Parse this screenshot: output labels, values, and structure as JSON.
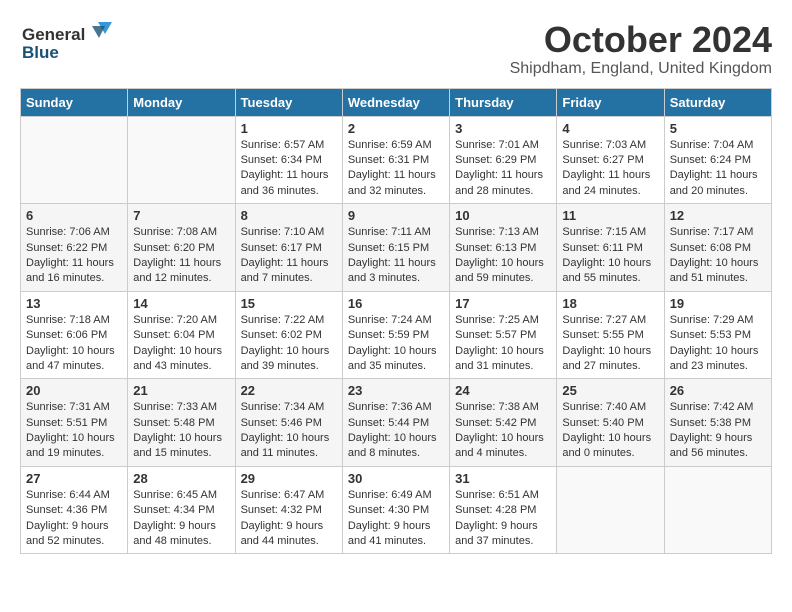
{
  "header": {
    "logo_general": "General",
    "logo_blue": "Blue",
    "month_title": "October 2024",
    "location": "Shipdham, England, United Kingdom"
  },
  "days_of_week": [
    "Sunday",
    "Monday",
    "Tuesday",
    "Wednesday",
    "Thursday",
    "Friday",
    "Saturday"
  ],
  "weeks": [
    [
      {
        "day": "",
        "sunrise": "",
        "sunset": "",
        "daylight": ""
      },
      {
        "day": "",
        "sunrise": "",
        "sunset": "",
        "daylight": ""
      },
      {
        "day": "1",
        "sunrise": "Sunrise: 6:57 AM",
        "sunset": "Sunset: 6:34 PM",
        "daylight": "Daylight: 11 hours and 36 minutes."
      },
      {
        "day": "2",
        "sunrise": "Sunrise: 6:59 AM",
        "sunset": "Sunset: 6:31 PM",
        "daylight": "Daylight: 11 hours and 32 minutes."
      },
      {
        "day": "3",
        "sunrise": "Sunrise: 7:01 AM",
        "sunset": "Sunset: 6:29 PM",
        "daylight": "Daylight: 11 hours and 28 minutes."
      },
      {
        "day": "4",
        "sunrise": "Sunrise: 7:03 AM",
        "sunset": "Sunset: 6:27 PM",
        "daylight": "Daylight: 11 hours and 24 minutes."
      },
      {
        "day": "5",
        "sunrise": "Sunrise: 7:04 AM",
        "sunset": "Sunset: 6:24 PM",
        "daylight": "Daylight: 11 hours and 20 minutes."
      }
    ],
    [
      {
        "day": "6",
        "sunrise": "Sunrise: 7:06 AM",
        "sunset": "Sunset: 6:22 PM",
        "daylight": "Daylight: 11 hours and 16 minutes."
      },
      {
        "day": "7",
        "sunrise": "Sunrise: 7:08 AM",
        "sunset": "Sunset: 6:20 PM",
        "daylight": "Daylight: 11 hours and 12 minutes."
      },
      {
        "day": "8",
        "sunrise": "Sunrise: 7:10 AM",
        "sunset": "Sunset: 6:17 PM",
        "daylight": "Daylight: 11 hours and 7 minutes."
      },
      {
        "day": "9",
        "sunrise": "Sunrise: 7:11 AM",
        "sunset": "Sunset: 6:15 PM",
        "daylight": "Daylight: 11 hours and 3 minutes."
      },
      {
        "day": "10",
        "sunrise": "Sunrise: 7:13 AM",
        "sunset": "Sunset: 6:13 PM",
        "daylight": "Daylight: 10 hours and 59 minutes."
      },
      {
        "day": "11",
        "sunrise": "Sunrise: 7:15 AM",
        "sunset": "Sunset: 6:11 PM",
        "daylight": "Daylight: 10 hours and 55 minutes."
      },
      {
        "day": "12",
        "sunrise": "Sunrise: 7:17 AM",
        "sunset": "Sunset: 6:08 PM",
        "daylight": "Daylight: 10 hours and 51 minutes."
      }
    ],
    [
      {
        "day": "13",
        "sunrise": "Sunrise: 7:18 AM",
        "sunset": "Sunset: 6:06 PM",
        "daylight": "Daylight: 10 hours and 47 minutes."
      },
      {
        "day": "14",
        "sunrise": "Sunrise: 7:20 AM",
        "sunset": "Sunset: 6:04 PM",
        "daylight": "Daylight: 10 hours and 43 minutes."
      },
      {
        "day": "15",
        "sunrise": "Sunrise: 7:22 AM",
        "sunset": "Sunset: 6:02 PM",
        "daylight": "Daylight: 10 hours and 39 minutes."
      },
      {
        "day": "16",
        "sunrise": "Sunrise: 7:24 AM",
        "sunset": "Sunset: 5:59 PM",
        "daylight": "Daylight: 10 hours and 35 minutes."
      },
      {
        "day": "17",
        "sunrise": "Sunrise: 7:25 AM",
        "sunset": "Sunset: 5:57 PM",
        "daylight": "Daylight: 10 hours and 31 minutes."
      },
      {
        "day": "18",
        "sunrise": "Sunrise: 7:27 AM",
        "sunset": "Sunset: 5:55 PM",
        "daylight": "Daylight: 10 hours and 27 minutes."
      },
      {
        "day": "19",
        "sunrise": "Sunrise: 7:29 AM",
        "sunset": "Sunset: 5:53 PM",
        "daylight": "Daylight: 10 hours and 23 minutes."
      }
    ],
    [
      {
        "day": "20",
        "sunrise": "Sunrise: 7:31 AM",
        "sunset": "Sunset: 5:51 PM",
        "daylight": "Daylight: 10 hours and 19 minutes."
      },
      {
        "day": "21",
        "sunrise": "Sunrise: 7:33 AM",
        "sunset": "Sunset: 5:48 PM",
        "daylight": "Daylight: 10 hours and 15 minutes."
      },
      {
        "day": "22",
        "sunrise": "Sunrise: 7:34 AM",
        "sunset": "Sunset: 5:46 PM",
        "daylight": "Daylight: 10 hours and 11 minutes."
      },
      {
        "day": "23",
        "sunrise": "Sunrise: 7:36 AM",
        "sunset": "Sunset: 5:44 PM",
        "daylight": "Daylight: 10 hours and 8 minutes."
      },
      {
        "day": "24",
        "sunrise": "Sunrise: 7:38 AM",
        "sunset": "Sunset: 5:42 PM",
        "daylight": "Daylight: 10 hours and 4 minutes."
      },
      {
        "day": "25",
        "sunrise": "Sunrise: 7:40 AM",
        "sunset": "Sunset: 5:40 PM",
        "daylight": "Daylight: 10 hours and 0 minutes."
      },
      {
        "day": "26",
        "sunrise": "Sunrise: 7:42 AM",
        "sunset": "Sunset: 5:38 PM",
        "daylight": "Daylight: 9 hours and 56 minutes."
      }
    ],
    [
      {
        "day": "27",
        "sunrise": "Sunrise: 6:44 AM",
        "sunset": "Sunset: 4:36 PM",
        "daylight": "Daylight: 9 hours and 52 minutes."
      },
      {
        "day": "28",
        "sunrise": "Sunrise: 6:45 AM",
        "sunset": "Sunset: 4:34 PM",
        "daylight": "Daylight: 9 hours and 48 minutes."
      },
      {
        "day": "29",
        "sunrise": "Sunrise: 6:47 AM",
        "sunset": "Sunset: 4:32 PM",
        "daylight": "Daylight: 9 hours and 44 minutes."
      },
      {
        "day": "30",
        "sunrise": "Sunrise: 6:49 AM",
        "sunset": "Sunset: 4:30 PM",
        "daylight": "Daylight: 9 hours and 41 minutes."
      },
      {
        "day": "31",
        "sunrise": "Sunrise: 6:51 AM",
        "sunset": "Sunset: 4:28 PM",
        "daylight": "Daylight: 9 hours and 37 minutes."
      },
      {
        "day": "",
        "sunrise": "",
        "sunset": "",
        "daylight": ""
      },
      {
        "day": "",
        "sunrise": "",
        "sunset": "",
        "daylight": ""
      }
    ]
  ]
}
